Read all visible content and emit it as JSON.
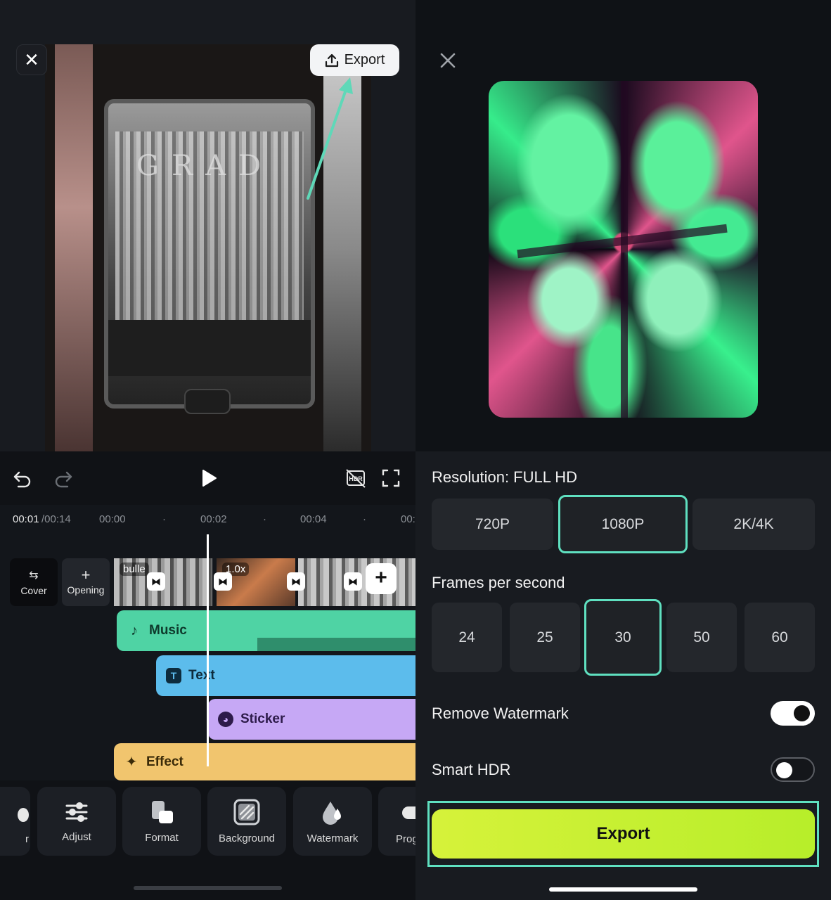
{
  "editor": {
    "close_icon": "close-icon",
    "export_button_label": "Export",
    "export_icon": "upload-icon",
    "preview_overlay_text": "GRAD",
    "controls": {
      "undo_icon": "undo-icon",
      "redo_icon": "redo-icon",
      "play_icon": "play-icon",
      "hdr_icon": "hdr-off-icon",
      "fullscreen_icon": "fullscreen-icon"
    },
    "timeline": {
      "current_time": "00:01",
      "total_time": "/00:14",
      "ruler": [
        "00:00",
        "00:02",
        "00:04",
        "00:"
      ],
      "cover_label": "Cover",
      "opening_label": "Opening",
      "clips": [
        {
          "tag": "bulle"
        },
        {
          "tag": "1.0x"
        },
        {
          "tag": ""
        }
      ],
      "tracks": {
        "music": "Music",
        "text": "Text",
        "sticker": "Sticker",
        "effect": "Effect"
      }
    },
    "toolbar": [
      {
        "label": "r"
      },
      {
        "label": "Adjust"
      },
      {
        "label": "Format"
      },
      {
        "label": "Background"
      },
      {
        "label": "Watermark"
      },
      {
        "label": "Prog"
      }
    ]
  },
  "export_panel": {
    "close_icon": "close-icon",
    "resolution_label": "Resolution: FULL HD",
    "resolutions": [
      "720P",
      "1080P",
      "2K/4K"
    ],
    "resolution_selected": "1080P",
    "fps_label": "Frames per second",
    "fps_options": [
      "24",
      "25",
      "30",
      "50",
      "60"
    ],
    "fps_selected": "30",
    "remove_watermark_label": "Remove Watermark",
    "remove_watermark_on": true,
    "smart_hdr_label": "Smart HDR",
    "smart_hdr_on": false,
    "export_button_label": "Export",
    "accent_color": "#5fe0c0",
    "export_button_color": "#c8f032"
  }
}
